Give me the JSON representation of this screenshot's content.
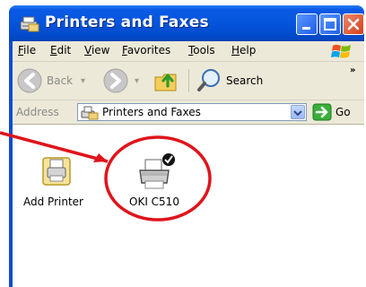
{
  "window": {
    "title": "Printers and Faxes",
    "title_icon": "printers-folder-icon",
    "controls": [
      "minimize-icon",
      "maximize-icon",
      "close-icon"
    ]
  },
  "menubar": {
    "items": [
      {
        "label": "File"
      },
      {
        "label": "Edit"
      },
      {
        "label": "View"
      },
      {
        "label": "Favorites"
      },
      {
        "label": "Tools"
      },
      {
        "label": "Help"
      }
    ],
    "logo_icon": "windows-flag-icon"
  },
  "toolbar": {
    "back_label": "Back",
    "search_label": "Search",
    "overflow": "»"
  },
  "address": {
    "label": "Address",
    "value": "Printers and Faxes",
    "go_label": "Go"
  },
  "items": [
    {
      "label": "Add Printer",
      "icon": "add-printer-icon"
    },
    {
      "label": "OKI C510",
      "icon": "printer-icon",
      "status": "default-printer-check"
    }
  ],
  "annotation": {
    "color": "#e0141b"
  }
}
